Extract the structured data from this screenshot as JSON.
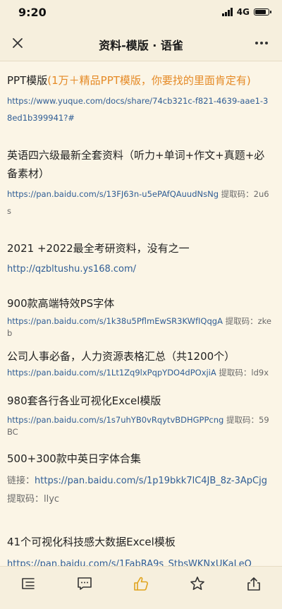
{
  "status": {
    "time": "9:20",
    "network": "4G",
    "battery_level": 0.9
  },
  "nav": {
    "title": "资料-模版 · 语雀"
  },
  "items": [
    {
      "title": "PPT模版",
      "title_accent": "(1万＋精品PPT模版，你要找的里面肯定有)",
      "link": "https://www.yuque.com/docs/share/74cb321c-f821-4639-aae1-38ed1b399941?#"
    },
    {
      "title": "英语四六级最新全套资料（听力+单词+作文+真题+必备素材）",
      "link": "https://pan.baidu.com/s/13FJ63n-u5ePAfQAuudNsNg",
      "code_text": " 提取码：2u6s"
    },
    {
      "title": "2021 +2022最全考研资料，没有之一",
      "link": "http://qzbltushu.ys168.com/"
    },
    {
      "title": "900款高端特效PS字体",
      "link": "https://pan.baidu.com/s/1k38u5PflmEwSR3KWfIQqgA",
      "code_text": " 提取码：zkeb"
    },
    {
      "title": "公司人事必备，人力资源表格汇总（共1200个）",
      "link": "https://pan.baidu.com/s/1Lt1Zq9lxPqpYDO4dPOxjiA",
      "code_text": " 提取码：ld9x"
    },
    {
      "title": "980套各行各业可视化Excel模版",
      "link": "https://pan.baidu.com/s/1s7uhYB0vRqytvBDHGPPcng",
      "code_text": " 提取码：59BC"
    },
    {
      "title": "500+300款中英日字体合集",
      "prefix": "链接：",
      "link": "https://pan.baidu.com/s/1p19bkk7lC4JB_8z-3ApCjg",
      "code_text": " 提取码：llyc"
    },
    {
      "title": "41个可视化科技感大数据Excel模板",
      "link": "https://pan.baidu.com/s/1FabRA9s_StbsWKNxUKaLeQ"
    }
  ],
  "toolbar": {
    "icons": [
      "outline-icon",
      "comment-icon",
      "like-icon",
      "star-icon",
      "share-icon"
    ]
  },
  "colors": {
    "background": "#fbf5e6",
    "bar": "#f6efdd",
    "link": "#2f5d95",
    "accent": "#e58a26",
    "like_active": "#e0a31c"
  }
}
